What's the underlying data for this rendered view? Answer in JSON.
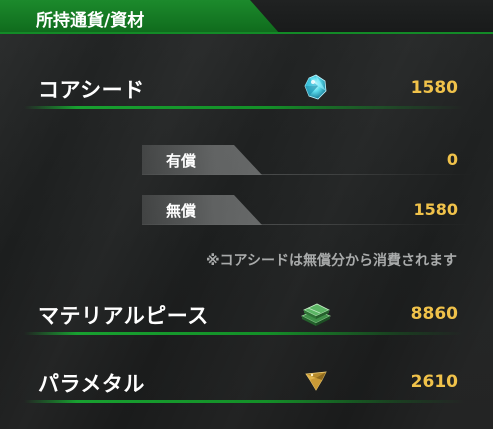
{
  "title": "所持通貨/資材",
  "rows": [
    {
      "label": "コアシード",
      "icon": "core-seed-crystal-icon",
      "value": "1580"
    },
    {
      "label": "マテリアルピース",
      "icon": "material-piece-stack-icon",
      "value": "8860"
    },
    {
      "label": "パラメタル",
      "icon": "parametal-ore-icon",
      "value": "2610"
    }
  ],
  "core_seed_breakdown": [
    {
      "label": "有償",
      "value": "0"
    },
    {
      "label": "無償",
      "value": "1580"
    }
  ],
  "note": "※コアシードは無償分から消費されます",
  "colors": {
    "accent_green": "#138a27",
    "value_gold": "#f0c24a",
    "background": "#1c1e1e",
    "note_gray": "#a9abab"
  }
}
